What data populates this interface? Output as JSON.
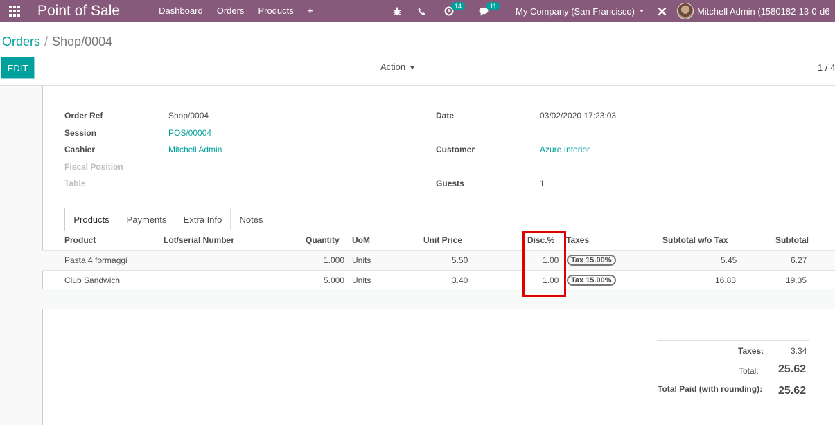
{
  "navbar": {
    "app_name": "Point of Sale",
    "menu": [
      "Dashboard",
      "Orders",
      "Products"
    ],
    "activity_count": "14",
    "messages_count": "11",
    "company": "My Company (San Francisco)",
    "user": "Mitchell Admin (1580182-13-0-d6",
    "colors": {
      "bar": "#875a7b",
      "badge": "#00a09d"
    }
  },
  "breadcrumb": {
    "parent": "Orders",
    "current": "Shop/0004"
  },
  "control": {
    "edit": "EDIT",
    "action": "Action",
    "pager": "1 / 4"
  },
  "form": {
    "order_ref_label": "Order Ref",
    "order_ref": "Shop/0004",
    "session_label": "Session",
    "session": "POS/00004",
    "cashier_label": "Cashier",
    "cashier": "Mitchell Admin",
    "fiscal_label": "Fiscal Position",
    "table_label": "Table",
    "date_label": "Date",
    "date": "03/02/2020 17:23:03",
    "customer_label": "Customer",
    "customer": "Azure Interior",
    "guests_label": "Guests",
    "guests": "1"
  },
  "tabs": [
    "Products",
    "Payments",
    "Extra Info",
    "Notes"
  ],
  "table": {
    "headers": [
      "Product",
      "Lot/serial Number",
      "Quantity",
      "UoM",
      "Unit Price",
      "Disc.%",
      "Taxes",
      "Subtotal w/o Tax",
      "Subtotal"
    ],
    "rows": [
      {
        "product": "Pasta 4 formaggi",
        "lot": "",
        "qty": "1.000",
        "uom": "Units",
        "price": "5.50",
        "disc": "1.00",
        "tax": "Tax 15.00%",
        "subtotal_wo": "5.45",
        "subtotal": "6.27"
      },
      {
        "product": "Club Sandwich",
        "lot": "",
        "qty": "5.000",
        "uom": "Units",
        "price": "3.40",
        "disc": "1.00",
        "tax": "Tax 15.00%",
        "subtotal_wo": "16.83",
        "subtotal": "19.35"
      }
    ]
  },
  "totals": {
    "taxes_label": "Taxes:",
    "taxes": "3.34",
    "total_label": "Total:",
    "total": "25.62",
    "paid_label": "Total Paid (with rounding):",
    "paid": "25.62"
  },
  "highlight_color": "#e00000"
}
